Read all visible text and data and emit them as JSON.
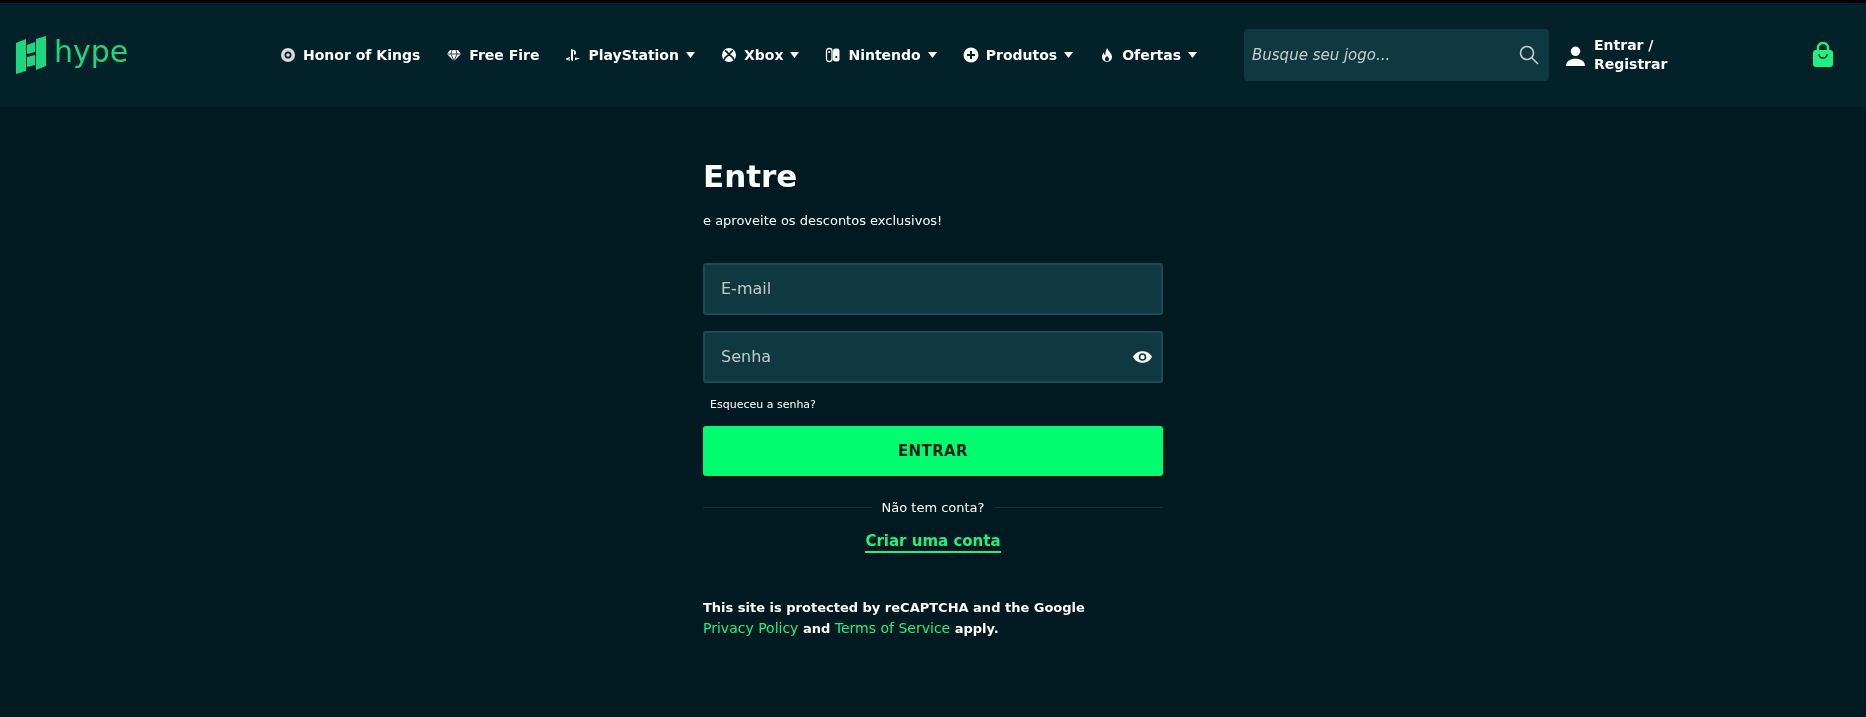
{
  "header": {
    "logo": "hype",
    "nav": [
      {
        "label": "Honor of Kings",
        "dropdown": false
      },
      {
        "label": "Free Fire",
        "dropdown": false
      },
      {
        "label": "PlayStation",
        "dropdown": true
      },
      {
        "label": "Xbox",
        "dropdown": true
      },
      {
        "label": "Nintendo",
        "dropdown": true
      },
      {
        "label": "Produtos",
        "dropdown": true
      },
      {
        "label": "Ofertas",
        "dropdown": true
      }
    ],
    "search": {
      "placeholder": "Busque seu jogo..."
    },
    "account": {
      "line1": "Entrar /",
      "line2": "Registrar"
    }
  },
  "login": {
    "title": "Entre",
    "subtitle": "e aproveite os descontos exclusivos!",
    "email": {
      "placeholder": "E-mail"
    },
    "password": {
      "placeholder": "Senha"
    },
    "forgot": "Esqueceu a senha?",
    "submit": "ENTRAR",
    "divider": "Não tem conta?",
    "create": "Criar uma conta",
    "recaptcha": {
      "before": "This site is protected by reCAPTCHA and the Google",
      "privacy": "Privacy Policy",
      "middle": "and",
      "terms": "Terms of Service",
      "after": "apply."
    }
  }
}
